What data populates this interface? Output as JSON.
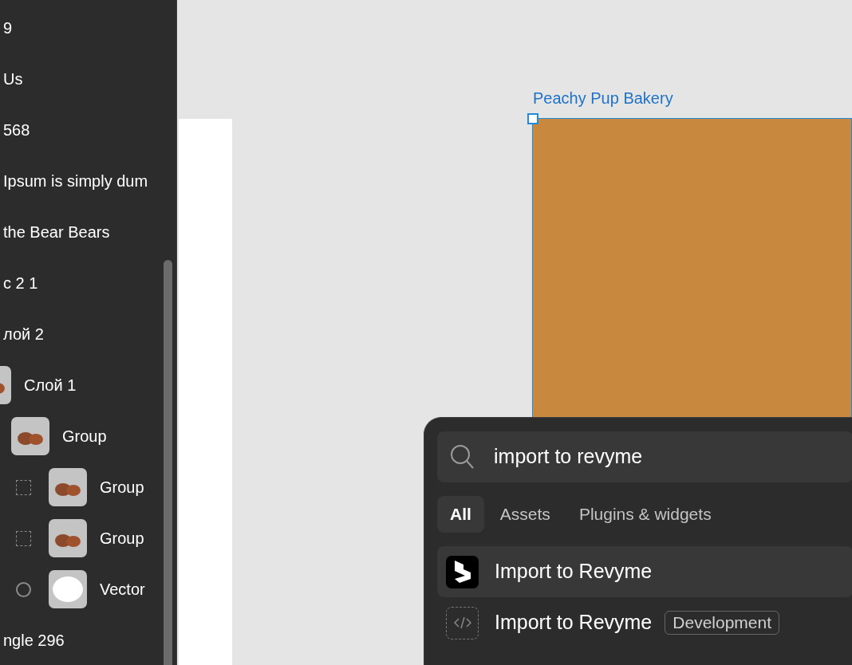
{
  "layers": [
    {
      "name": "9",
      "kind": "text-only"
    },
    {
      "name": "Us",
      "kind": "text-only"
    },
    {
      "name": "568",
      "kind": "text-only"
    },
    {
      "name": "Ipsum is simply dum",
      "kind": "text-only"
    },
    {
      "name": "the Bear Bears",
      "kind": "text-only"
    },
    {
      "name": "c 2 1",
      "kind": "text-only"
    },
    {
      "name": "лой 2",
      "kind": "text-only"
    },
    {
      "name": "Слой 1",
      "kind": "image",
      "children": [
        {
          "name": "Group",
          "kind": "image",
          "children": [
            {
              "name": "Group",
              "kind": "image"
            },
            {
              "name": "Group",
              "kind": "image"
            },
            {
              "name": "Vector",
              "kind": "vector"
            }
          ]
        }
      ]
    },
    {
      "name": "ngle 296",
      "kind": "text-only"
    }
  ],
  "canvas": {
    "frame_label": "Peachy Pup Bakery"
  },
  "quick_actions": {
    "query": "import to revyme",
    "tabs": [
      {
        "label": "All",
        "selected": true
      },
      {
        "label": "Assets",
        "selected": false
      },
      {
        "label": "Plugins & widgets",
        "selected": false
      }
    ],
    "results": [
      {
        "label": "Import to Revyme",
        "kind": "plugin",
        "selected": true
      },
      {
        "label": "Import to Revyme",
        "kind": "development",
        "selected": false,
        "badge": "Development"
      }
    ]
  }
}
